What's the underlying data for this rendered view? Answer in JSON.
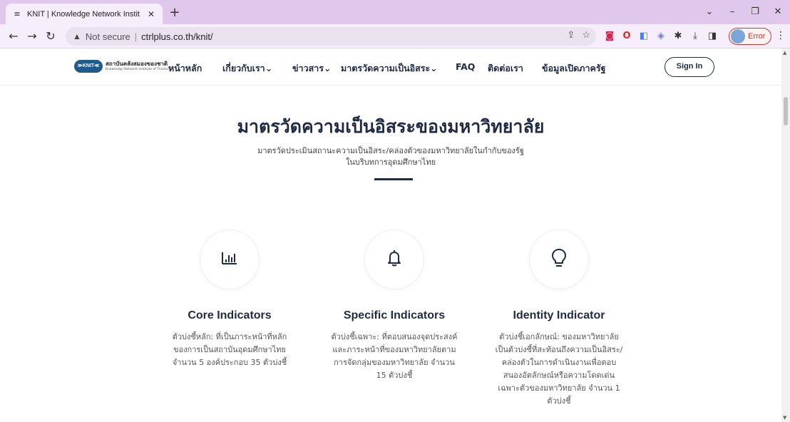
{
  "browser": {
    "tab_title": "KNIT | Knowledge Network Instit",
    "new_tab": "+",
    "close": "✕",
    "address": {
      "warning": "Not secure",
      "separator": "|",
      "url": "ctrlplus.co.th/knit/"
    },
    "profile": "Error"
  },
  "site": {
    "logo": {
      "badge": "≫KNIT≪",
      "line1": "สถาบันคลังสมองของชาติ",
      "line2": "Knowledge Network Institute of Thailand"
    },
    "nav": {
      "home": "หน้าหลัก",
      "about": "เกี่ยวกับเรา⌄",
      "news": "ข่าวสาร⌄",
      "autonomy": "มาตรวัดความเป็นอิสระ⌄",
      "faq": "FAQ",
      "contact": "ติดต่อเรา",
      "open_data": "ข้อมูลเปิดภาครัฐ",
      "sign_in": "Sign In"
    },
    "hero": {
      "title": "มาตรวัดความเป็นอิสระของมหาวิทยาลัย",
      "subtitle_1": "มาตรวัดประเมินสถานะความเป็นอิสระ/คล่องตัวของมหาวิทยาลัยในกำกับของรัฐ",
      "subtitle_2": "ในบริบทการอุดมศึกษาไทย"
    },
    "cards": [
      {
        "icon": "bar-chart-icon",
        "title": "Core Indicators",
        "desc": "ตัวบ่งชี้หลัก: ที่เป็นภาระหน้าที่หลักของการเป็นสถาบันอุดมศึกษาไทย จำนวน 5 องค์ประกอบ 35 ตัวบ่งชี้"
      },
      {
        "icon": "bell-icon",
        "title": "Specific Indicators",
        "desc": "ตัวบ่งชี้เฉพาะ: ที่ตอบสนองจุดประสงค์และภาระหน้าที่ของมหาวิทยาลัยตามการจัดกลุ่มของมหาวิทยาลัย จำนวน 15 ตัวบ่งชี้"
      },
      {
        "icon": "lightbulb-icon",
        "title": "Identity Indicator",
        "desc": "ตัวบ่งชี้เอกลักษณ์: ของมหาวิทยาลัย เป็นตัวบ่งชี้ที่สะท้อนถึงความเป็นอิสระ/คล่องตัวในการดำเนินงานเพื่อตอบสนองอัตลักษณ์หรือความโดดเด่นเฉพาะตัวของมหาวิทยาลัย จำนวน 1 ตัวบ่งชี้"
      }
    ]
  }
}
